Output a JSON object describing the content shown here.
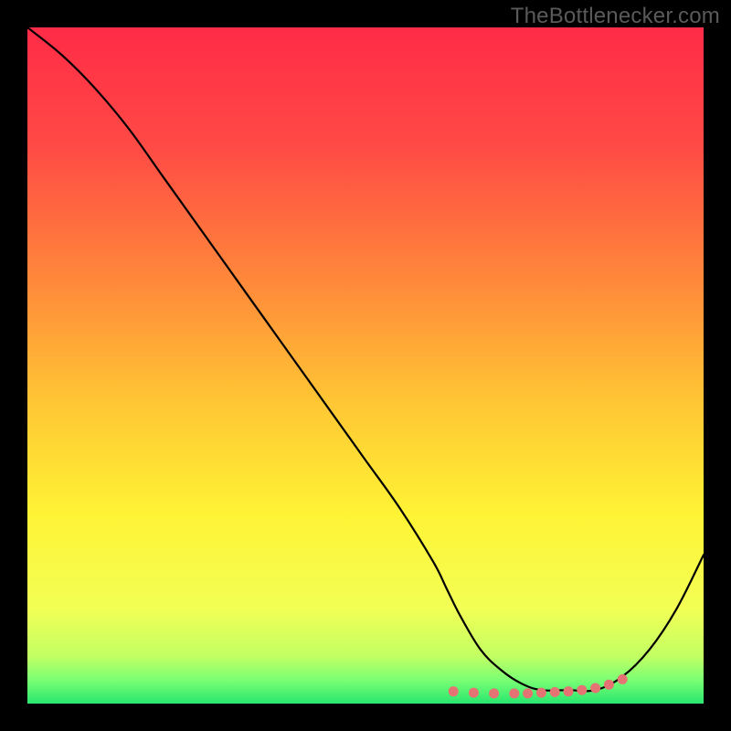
{
  "attribution": "TheBottlenecker.com",
  "chart_data": {
    "type": "line",
    "title": "",
    "xlabel": "",
    "ylabel": "",
    "xlim": [
      0,
      100
    ],
    "ylim": [
      0,
      100
    ],
    "grid": false,
    "background_gradient": {
      "stops": [
        {
          "offset": 0.0,
          "color": "#ff2b47"
        },
        {
          "offset": 0.18,
          "color": "#ff4b45"
        },
        {
          "offset": 0.38,
          "color": "#ff8a3a"
        },
        {
          "offset": 0.55,
          "color": "#ffc534"
        },
        {
          "offset": 0.72,
          "color": "#fff335"
        },
        {
          "offset": 0.86,
          "color": "#f2ff55"
        },
        {
          "offset": 0.93,
          "color": "#c2ff63"
        },
        {
          "offset": 0.965,
          "color": "#7bff74"
        },
        {
          "offset": 1.0,
          "color": "#29e66f"
        }
      ]
    },
    "series": [
      {
        "name": "bottleneck-curve",
        "color": "#000000",
        "stroke_width": 2.2,
        "x": [
          0,
          5,
          10,
          15,
          20,
          25,
          30,
          35,
          40,
          45,
          50,
          55,
          60,
          62,
          64,
          67,
          70,
          73,
          76,
          80,
          84,
          88,
          92,
          96,
          100
        ],
        "values": [
          100,
          96,
          91,
          85,
          78,
          71,
          64,
          57,
          50,
          43,
          36,
          29,
          21,
          17,
          13,
          8,
          5,
          3,
          2,
          2,
          2,
          4,
          8,
          14,
          22
        ]
      },
      {
        "name": "optimal-range-markers",
        "color": "#e57373",
        "marker_radius": 5.5,
        "type": "scatter",
        "x": [
          63,
          66,
          69,
          72,
          74,
          76,
          78,
          80,
          82,
          84,
          86,
          88
        ],
        "values": [
          1.8,
          1.6,
          1.5,
          1.5,
          1.5,
          1.6,
          1.7,
          1.8,
          2.0,
          2.3,
          2.8,
          3.6
        ]
      }
    ]
  }
}
